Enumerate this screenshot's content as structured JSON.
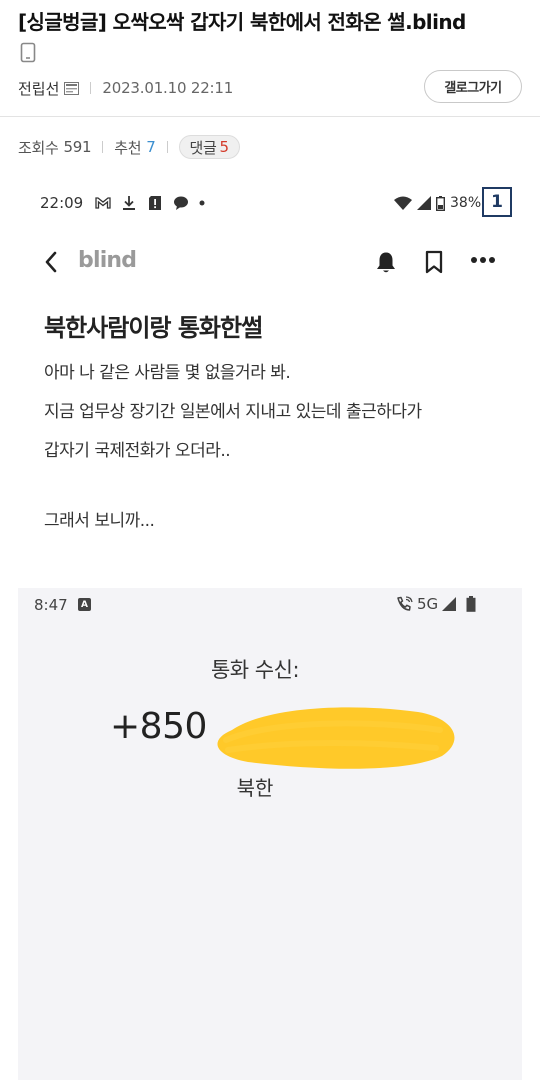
{
  "post": {
    "title": "[싱글벙글] 오싹오싹 갑자기 북한에서 전화온 썰.blind",
    "author": "전립선",
    "date": "2023.01.10 22:11",
    "gallog_button": "갤로그가기",
    "views_label": "조회수",
    "views": "591",
    "recommend_label": "추천",
    "recommend": "7",
    "comments_label": "댓글",
    "comments": "5"
  },
  "screenshot1": {
    "status_time": "22:09",
    "battery": "38%",
    "page_badge": "1",
    "brand": "blind",
    "title": "북한사람이랑 통화한썰",
    "lines": [
      "아마 나 같은 사람들 몇 없을거라 봐.",
      "지금 업무상 장기간 일본에서 지내고 있는데 출근하다가",
      "갑자기 국제전화가 오더라..",
      "그래서 보니까..."
    ]
  },
  "screenshot2": {
    "status_time": "8:47",
    "status_a": "A",
    "network": "5G",
    "call_label": "통화 수신:",
    "call_number": "+850",
    "call_location": "북한",
    "scribble_color": "#ffc929"
  },
  "icons": [
    "mobile-icon",
    "memo-icon",
    "mail-icon",
    "download-icon",
    "alert-icon",
    "chat-icon",
    "wifi-icon",
    "signal-icon",
    "battery-icon",
    "back-icon",
    "bell-icon",
    "bookmark-icon",
    "more-icon",
    "phone-wifi-icon"
  ]
}
